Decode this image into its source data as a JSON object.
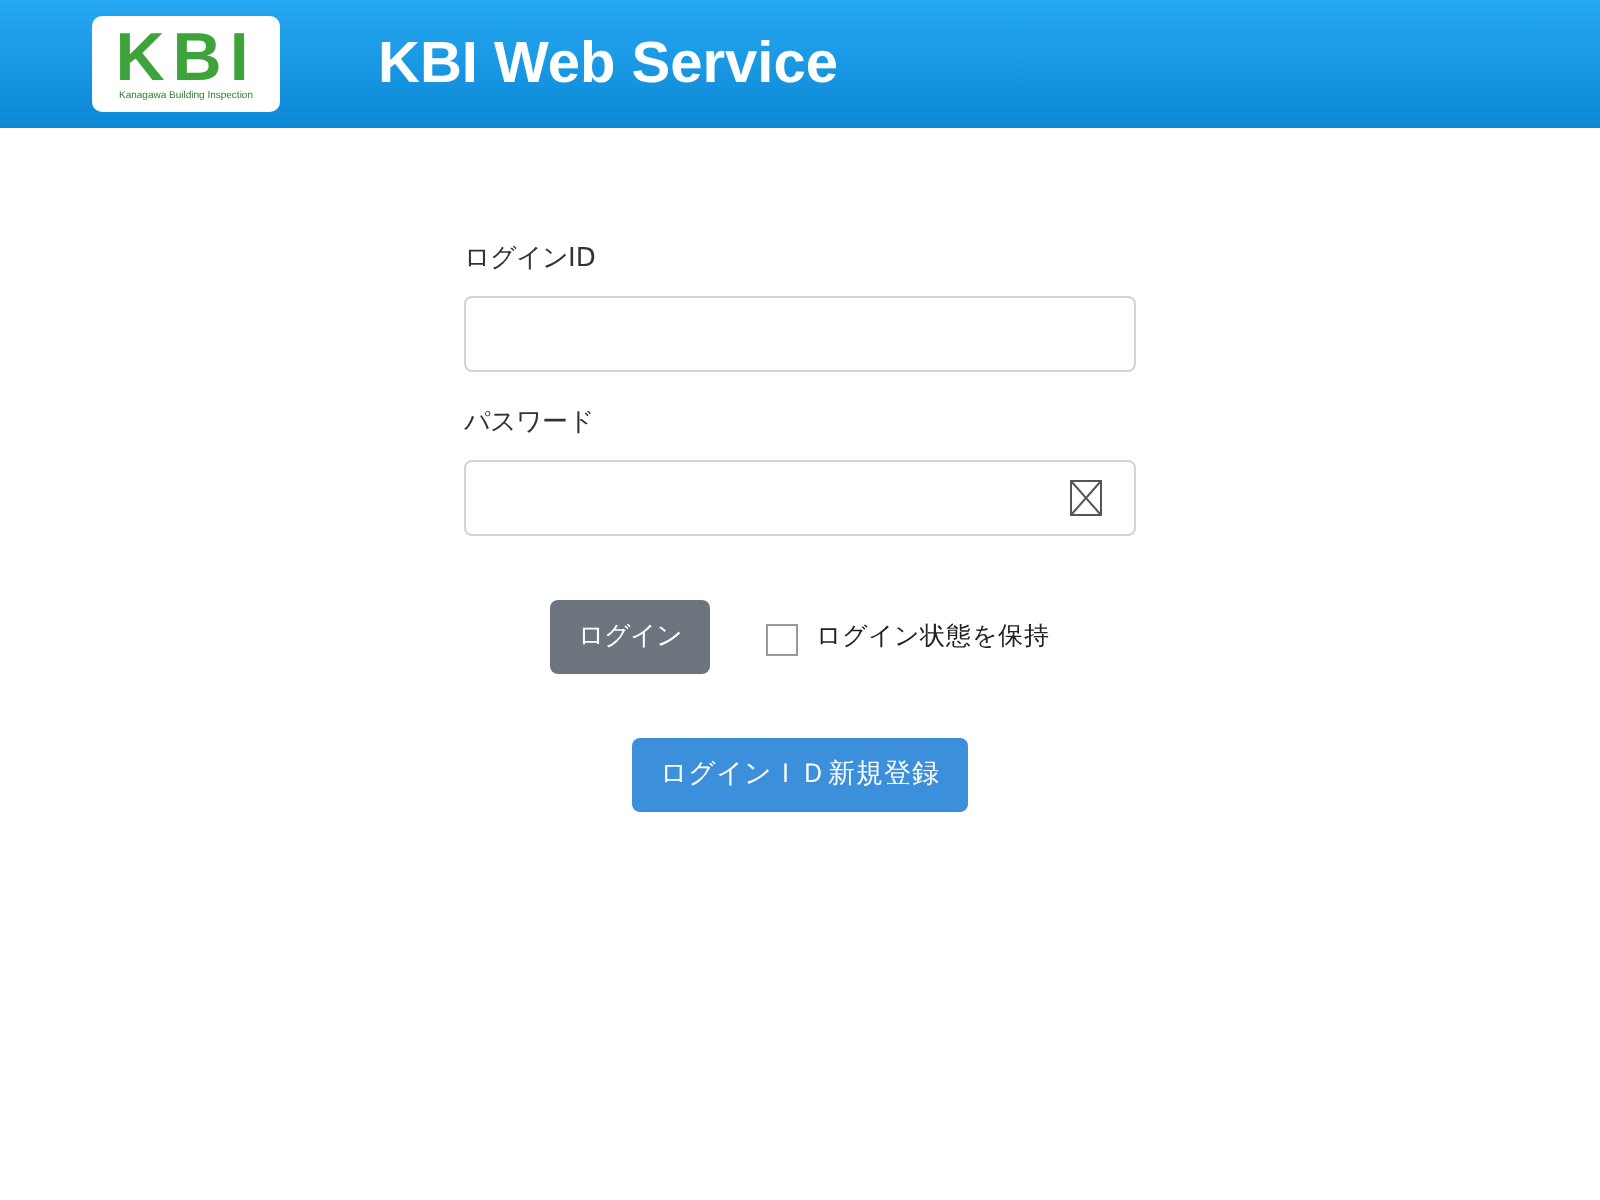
{
  "header": {
    "logo": {
      "letters": "KBI",
      "caption": "Kanagawa Building Inspection"
    },
    "title": "KBI Web Service"
  },
  "form": {
    "fields": [
      {
        "label": "ログインID",
        "kind": "text"
      },
      {
        "label": "パスワード",
        "kind": "password"
      }
    ],
    "login_button": "ログイン",
    "remember": {
      "label": "ログイン状態を保持",
      "checked": false
    },
    "register_button": "ログインＩＤ新規登録"
  }
}
